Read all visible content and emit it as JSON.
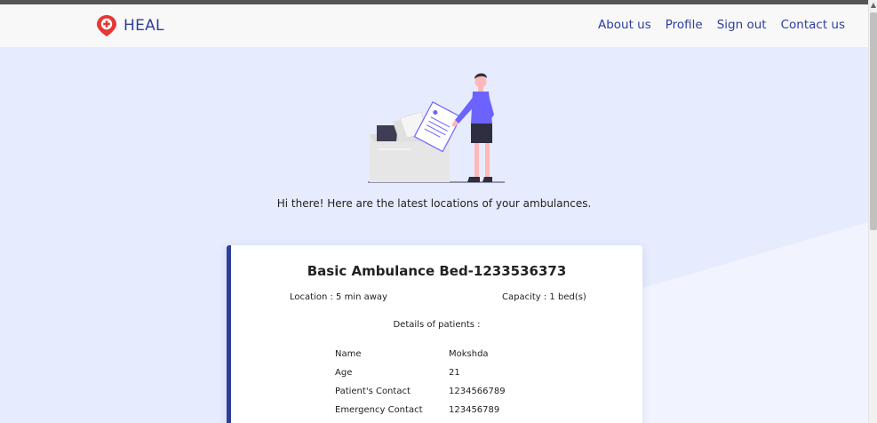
{
  "brand": {
    "name": "HEAL",
    "logo": "location-pin-medical-icon"
  },
  "nav": {
    "items": [
      {
        "label": "About us"
      },
      {
        "label": "Profile"
      },
      {
        "label": "Sign out"
      },
      {
        "label": "Contact us"
      }
    ]
  },
  "hero": {
    "illustration": "person-with-documents-illustration",
    "greeting": "Hi there! Here are the latest locations of your ambulances."
  },
  "ambulance": {
    "title": "Basic Ambulance Bed-1233536373",
    "location": "Location : 5 min away",
    "capacity": "Capacity : 1 bed(s)",
    "details_title": "Details of patients :",
    "patient": {
      "name_label": "Name",
      "name_value": "Mokshda",
      "age_label": "Age",
      "age_value": "21",
      "contact_label": "Patient's Contact",
      "contact_value": "1234566789",
      "emergency_label": "Emergency Contact",
      "emergency_value": "123456789"
    }
  },
  "colors": {
    "brand": "#2e3e9c",
    "background": "#e6ecfd",
    "navbar": "#f8f8f8",
    "accent_figure": "#6c63ff",
    "logo_red": "#e53935"
  }
}
